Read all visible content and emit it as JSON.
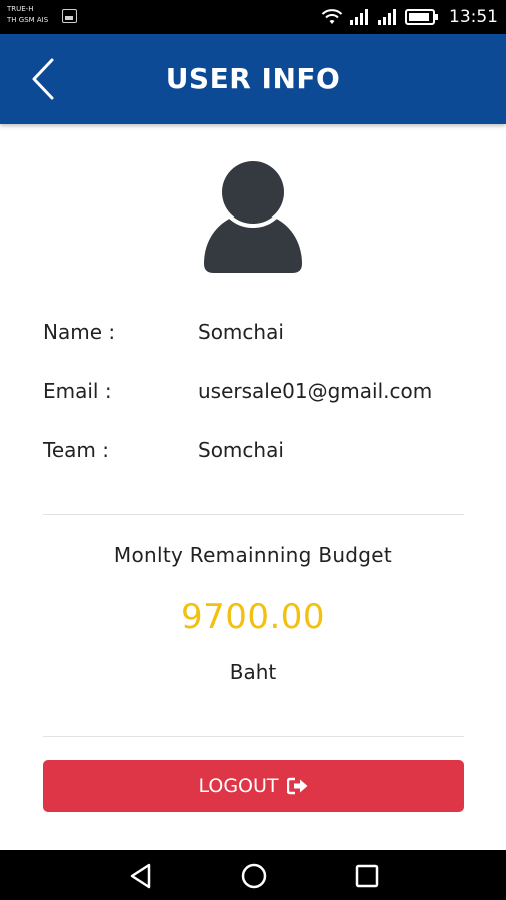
{
  "status_bar": {
    "carrier_line1": "TRUE-H",
    "carrier_line2": "TH GSM AIS",
    "time": "13:51"
  },
  "header": {
    "title": "USER INFO"
  },
  "user": {
    "name_label": "Name :",
    "name_value": "Somchai",
    "email_label": "Email :",
    "email_value": "usersale01@gmail.com",
    "team_label": "Team :",
    "team_value": "Somchai"
  },
  "budget": {
    "title": "Monlty Remainning Budget",
    "value": "9700.00",
    "unit": "Baht"
  },
  "actions": {
    "logout_label": "LOGOUT"
  },
  "colors": {
    "header_bg": "#0c4a95",
    "budget_value": "#f2c00f",
    "logout_bg": "#de3547",
    "avatar": "#343a40"
  },
  "icons": {
    "back": "chevron-left-icon",
    "avatar": "user-icon",
    "logout": "sign-out-icon",
    "wifi": "wifi-icon",
    "signal": "signal-icon",
    "battery": "battery-icon"
  }
}
